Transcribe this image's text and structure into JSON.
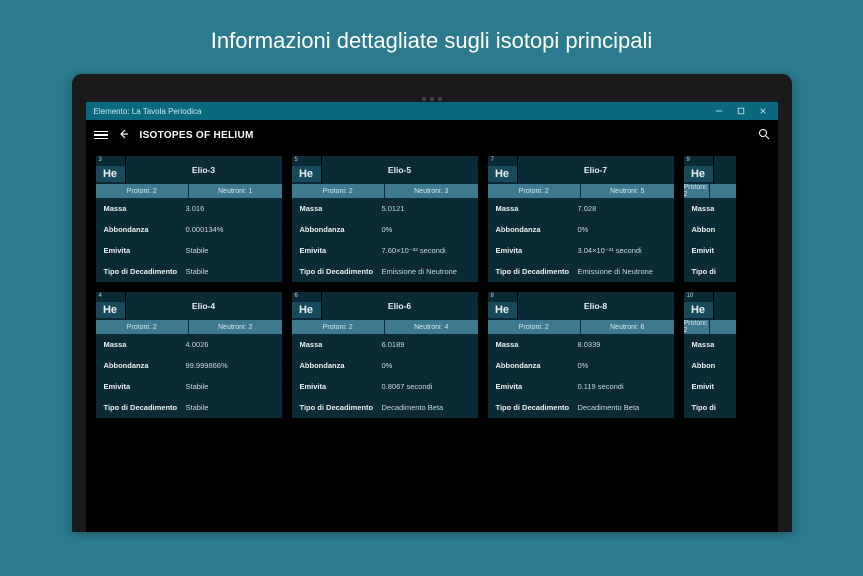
{
  "page_title": "Informazioni dettagliate sugli isotopi principali",
  "titlebar": {
    "app_name": "Elemento: La Tavola Periodica"
  },
  "appbar": {
    "title": "ISOTOPES OF HELIUM"
  },
  "symbol": "He",
  "proton_label": "Protoni: 2",
  "row_labels": {
    "mass": "Massa",
    "abundance": "Abbondanza",
    "halflife": "Emivita",
    "decay": "Tipo di Decadimento"
  },
  "isotopes": [
    {
      "n": "3",
      "name": "Elio-3",
      "neutron": "Neutroni: 1",
      "mass": "3.016",
      "abundance": "0.000134%",
      "halflife": "Stabile",
      "decay": "Stabile"
    },
    {
      "n": "5",
      "name": "Elio-5",
      "neutron": "Neutroni: 3",
      "mass": "5.0121",
      "abundance": "0%",
      "halflife": "7.60×10⁻²² secondi",
      "decay": "Emissione di Neutrone"
    },
    {
      "n": "7",
      "name": "Elio-7",
      "neutron": "Neutroni: 5",
      "mass": "7.028",
      "abundance": "0%",
      "halflife": "3.04×10⁻²¹ secondi",
      "decay": "Emissione di Neutrone"
    },
    {
      "n": "9",
      "name": "",
      "neutron": "",
      "mass": "",
      "abundance": "",
      "halflife": "",
      "decay": ""
    },
    {
      "n": "4",
      "name": "Elio-4",
      "neutron": "Neutroni: 2",
      "mass": "4.0026",
      "abundance": "99.999866%",
      "halflife": "Stabile",
      "decay": "Stabile"
    },
    {
      "n": "6",
      "name": "Elio-6",
      "neutron": "Neutroni: 4",
      "mass": "6.0189",
      "abundance": "0%",
      "halflife": "0.8067 secondi",
      "decay": "Decadimento Beta"
    },
    {
      "n": "8",
      "name": "Elio-8",
      "neutron": "Neutroni: 6",
      "mass": "8.0339",
      "abundance": "0%",
      "halflife": "0.119 secondi",
      "decay": "Decadimento Beta"
    },
    {
      "n": "10",
      "name": "",
      "neutron": "",
      "mass": "",
      "abundance": "",
      "halflife": "",
      "decay": ""
    }
  ],
  "partial_labels": {
    "mass": "Massa",
    "abundance": "Abbon",
    "halflife": "Emivit",
    "decay": "Tipo di"
  }
}
